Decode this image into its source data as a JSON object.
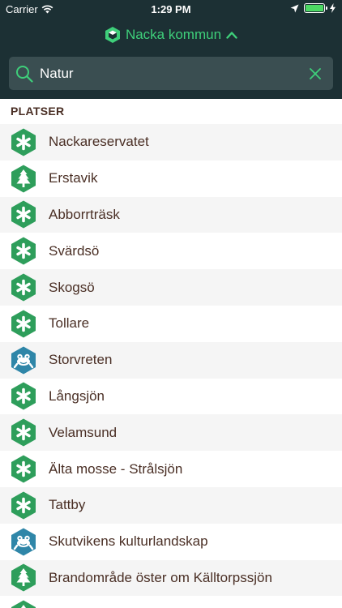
{
  "status": {
    "carrier": "Carrier",
    "time": "1:29 PM"
  },
  "header": {
    "title": "Nacka kommun"
  },
  "search": {
    "value": "Natur"
  },
  "section": {
    "title": "PLATSER"
  },
  "colors": {
    "header_bg": "#1c3034",
    "accent": "#3ecf7a",
    "nature_green": "#2e9e5b",
    "water_blue": "#2f86a8",
    "text_brown": "#4a2f25"
  },
  "places": [
    {
      "name": "Nackareservatet",
      "icon": "asterisk-icon"
    },
    {
      "name": "Erstavik",
      "icon": "tree-icon"
    },
    {
      "name": "Abborrträsk",
      "icon": "asterisk-icon"
    },
    {
      "name": "Svärdsö",
      "icon": "asterisk-icon"
    },
    {
      "name": "Skogsö",
      "icon": "asterisk-icon"
    },
    {
      "name": "Tollare",
      "icon": "asterisk-icon"
    },
    {
      "name": "Storvreten",
      "icon": "frog-icon"
    },
    {
      "name": "Långsjön",
      "icon": "asterisk-icon"
    },
    {
      "name": "Velamsund",
      "icon": "asterisk-icon"
    },
    {
      "name": "Älta mosse - Strålsjön",
      "icon": "asterisk-icon"
    },
    {
      "name": "Tattby",
      "icon": "asterisk-icon"
    },
    {
      "name": "Skutvikens kulturlandskap",
      "icon": "frog-icon"
    },
    {
      "name": "Brandområde öster om Källtorpssjön",
      "icon": "tree-icon"
    },
    {
      "name": "",
      "icon": "tree-icon"
    }
  ]
}
